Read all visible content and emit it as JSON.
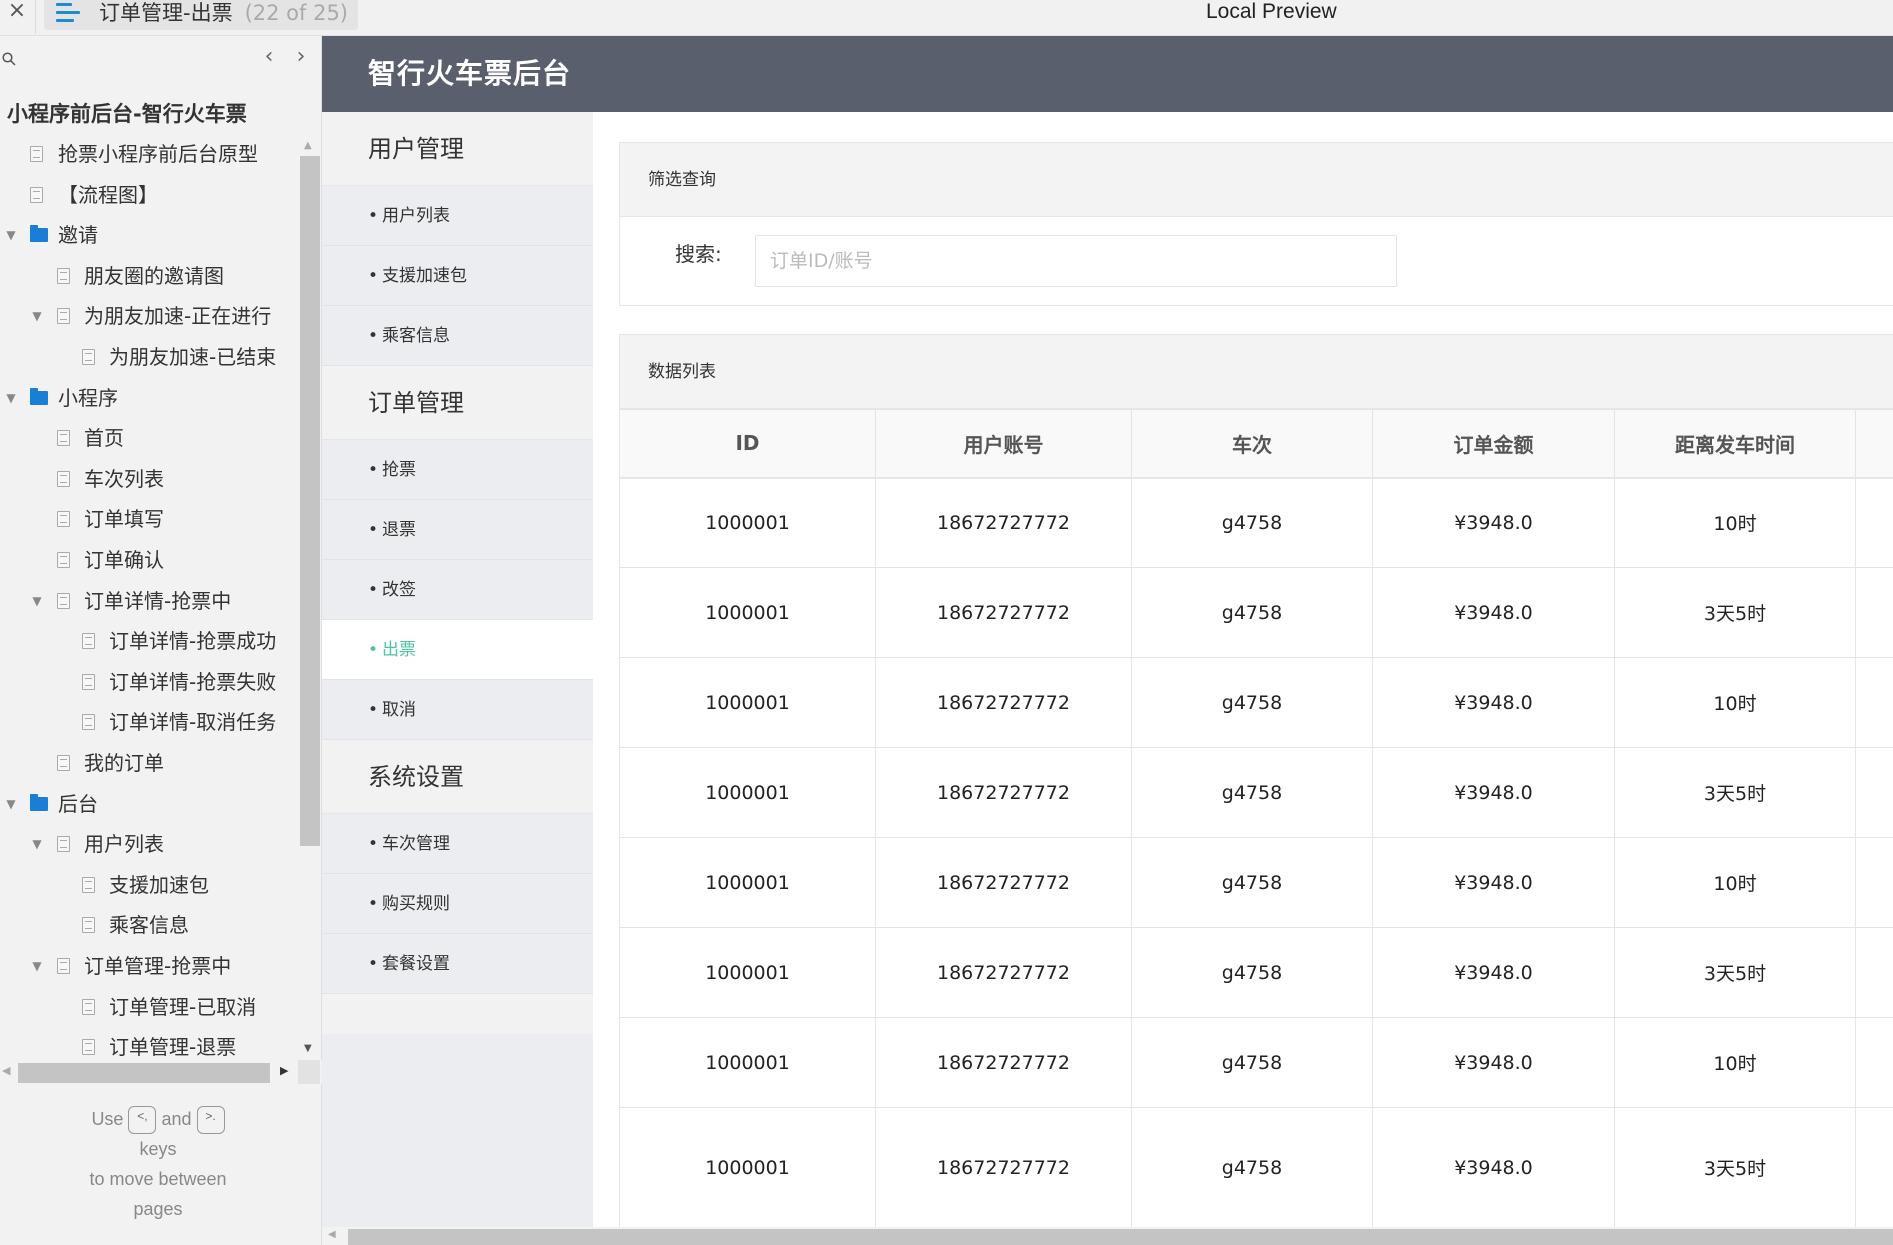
{
  "topbar": {
    "close_icon": "×",
    "page_title": "订单管理-出票",
    "page_count": "(22 of 25)",
    "app_title": "Local Preview"
  },
  "sitemap": {
    "prev_icon": "‹",
    "next_icon": "›",
    "project_title": "小程序前后台-智行火车票",
    "items": [
      {
        "label": "抢票小程序前后台原型",
        "type": "page",
        "level": 1,
        "caret": false
      },
      {
        "label": "【流程图】",
        "type": "page",
        "level": 1,
        "caret": false
      },
      {
        "label": "邀请",
        "type": "folder",
        "level": 0,
        "caret": true
      },
      {
        "label": "朋友圈的邀请图",
        "type": "page",
        "level": 2,
        "caret": false
      },
      {
        "label": "为朋友加速-正在进行",
        "type": "page",
        "level": 2,
        "caret": true
      },
      {
        "label": "为朋友加速-已结束",
        "type": "page",
        "level": 3,
        "caret": false
      },
      {
        "label": "小程序",
        "type": "folder",
        "level": 0,
        "caret": true
      },
      {
        "label": "首页",
        "type": "page",
        "level": 2,
        "caret": false
      },
      {
        "label": "车次列表",
        "type": "page",
        "level": 2,
        "caret": false
      },
      {
        "label": "订单填写",
        "type": "page",
        "level": 2,
        "caret": false
      },
      {
        "label": "订单确认",
        "type": "page",
        "level": 2,
        "caret": false
      },
      {
        "label": "订单详情-抢票中",
        "type": "page",
        "level": 2,
        "caret": true
      },
      {
        "label": "订单详情-抢票成功",
        "type": "page",
        "level": 3,
        "caret": false
      },
      {
        "label": "订单详情-抢票失败",
        "type": "page",
        "level": 3,
        "caret": false
      },
      {
        "label": "订单详情-取消任务",
        "type": "page",
        "level": 3,
        "caret": false
      },
      {
        "label": "我的订单",
        "type": "page",
        "level": 2,
        "caret": false
      },
      {
        "label": "后台",
        "type": "folder",
        "level": 0,
        "caret": true
      },
      {
        "label": "用户列表",
        "type": "page",
        "level": 2,
        "caret": true
      },
      {
        "label": "支援加速包",
        "type": "page",
        "level": 3,
        "caret": false
      },
      {
        "label": "乘客信息",
        "type": "page",
        "level": 3,
        "caret": false
      },
      {
        "label": "订单管理-抢票中",
        "type": "page",
        "level": 2,
        "caret": true
      },
      {
        "label": "订单管理-已取消",
        "type": "page",
        "level": 3,
        "caret": false
      },
      {
        "label": "订单管理-退票",
        "type": "page",
        "level": 3,
        "caret": false
      }
    ],
    "help": {
      "use": "Use",
      "prev_key": "<,",
      "and": "and",
      "next_key": ">.",
      "keys": "keys",
      "line3": "to move between",
      "line4": "pages"
    }
  },
  "admin": {
    "brand": "智行火车票后台",
    "accent_color": "#4bc5a4",
    "header_color": "#5a5f6e",
    "nav": [
      {
        "group": "用户管理",
        "items": [
          "用户列表",
          "支援加速包",
          "乘客信息"
        ]
      },
      {
        "group": "订单管理",
        "items": [
          "抢票",
          "退票",
          "改签",
          "出票",
          "取消"
        ]
      },
      {
        "group": "系统设置",
        "items": [
          "车次管理",
          "购买规则",
          "套餐设置"
        ]
      }
    ],
    "active_item": "出票",
    "bullet": "•",
    "filter": {
      "title": "筛选查询",
      "search_label": "搜索:",
      "search_placeholder": "订单ID/账号",
      "search_value": ""
    },
    "datalist": {
      "title": "数据列表",
      "columns": [
        "ID",
        "用户账号",
        "车次",
        "订单金额",
        "距离发车时间",
        ""
      ],
      "rows": [
        [
          "1000001",
          "18672727772",
          "g4758",
          "¥3948.0",
          "10时",
          ""
        ],
        [
          "1000001",
          "18672727772",
          "g4758",
          "¥3948.0",
          "3天5时",
          ""
        ],
        [
          "1000001",
          "18672727772",
          "g4758",
          "¥3948.0",
          "10时",
          ""
        ],
        [
          "1000001",
          "18672727772",
          "g4758",
          "¥3948.0",
          "3天5时",
          ""
        ],
        [
          "1000001",
          "18672727772",
          "g4758",
          "¥3948.0",
          "10时",
          ""
        ],
        [
          "1000001",
          "18672727772",
          "g4758",
          "¥3948.0",
          "3天5时",
          ""
        ],
        [
          "1000001",
          "18672727772",
          "g4758",
          "¥3948.0",
          "10时",
          ""
        ],
        [
          "1000001",
          "18672727772",
          "g4758",
          "¥3948.0",
          "3天5时",
          ""
        ]
      ]
    }
  }
}
